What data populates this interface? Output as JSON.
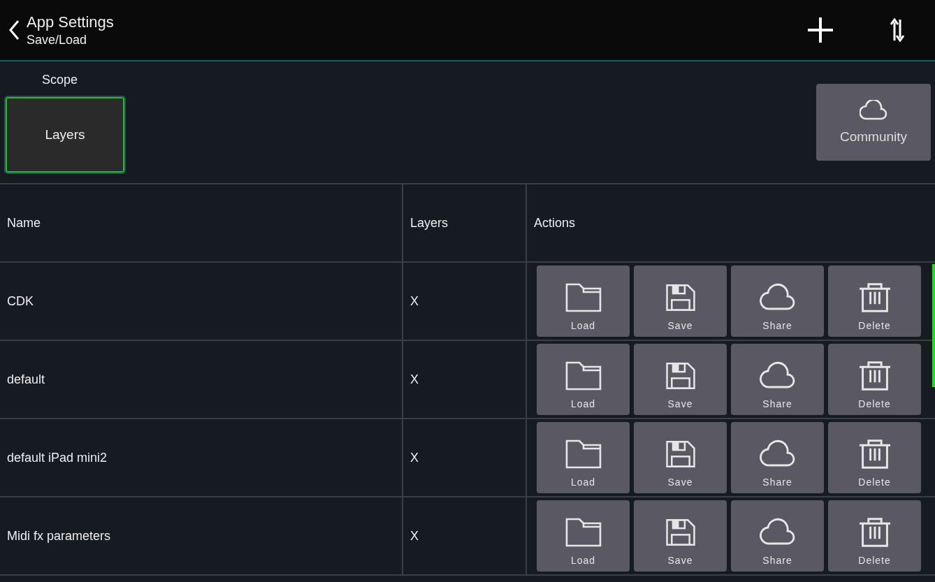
{
  "header": {
    "title": "App Settings",
    "subtitle": "Save/Load"
  },
  "scope": {
    "label": "Scope",
    "options": [
      {
        "label": "Layers",
        "selected": true
      }
    ]
  },
  "community_button": {
    "label": "Community"
  },
  "table": {
    "columns": [
      "Name",
      "Layers",
      "Actions"
    ],
    "rows": [
      {
        "name": "CDK",
        "layers": "X",
        "actions": [
          {
            "kind": "load",
            "label": "Load"
          },
          {
            "kind": "save",
            "label": "Save"
          },
          {
            "kind": "share",
            "label": "Share"
          },
          {
            "kind": "delete",
            "label": "Delete"
          }
        ]
      },
      {
        "name": "default",
        "layers": "X",
        "actions": [
          {
            "kind": "load",
            "label": "Load"
          },
          {
            "kind": "save",
            "label": "Save"
          },
          {
            "kind": "share",
            "label": "Share"
          },
          {
            "kind": "delete",
            "label": "Delete"
          }
        ]
      },
      {
        "name": "default iPad mini2",
        "layers": "X",
        "actions": [
          {
            "kind": "load",
            "label": "Load"
          },
          {
            "kind": "save",
            "label": "Save"
          },
          {
            "kind": "share",
            "label": "Share"
          },
          {
            "kind": "delete",
            "label": "Delete"
          }
        ]
      },
      {
        "name": "Midi fx parameters",
        "layers": "X",
        "actions": [
          {
            "kind": "load",
            "label": "Load"
          },
          {
            "kind": "save",
            "label": "Save"
          },
          {
            "kind": "share",
            "label": "Share"
          },
          {
            "kind": "delete",
            "label": "Delete"
          }
        ]
      }
    ]
  }
}
